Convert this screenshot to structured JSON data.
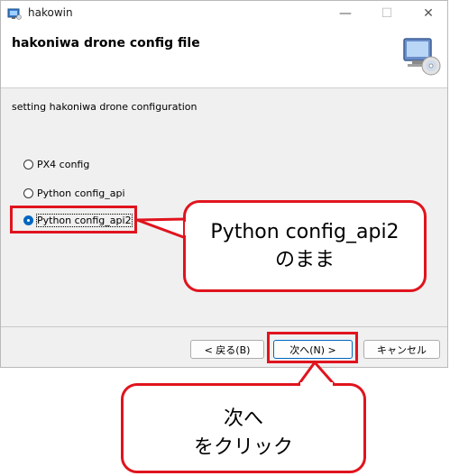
{
  "window": {
    "title": "hakowin",
    "controls": {
      "minimize": "—",
      "maximize": "☐",
      "close": "✕"
    }
  },
  "header": {
    "title": "hakoniwa drone config file",
    "icon": "computer-cd-icon"
  },
  "instruction": "setting hakoniwa drone configuration",
  "options": [
    {
      "label": "PX4 config",
      "checked": false
    },
    {
      "label": "Python config_api",
      "checked": false
    },
    {
      "label": "Python config_api2",
      "checked": true
    }
  ],
  "buttons": {
    "back": "< 戻る(B)",
    "next": "次へ(N) >",
    "cancel": "キャンセル"
  },
  "callouts": {
    "option": {
      "line1": "Python config_api2",
      "line2": "のまま"
    },
    "next": {
      "line1": "次へ",
      "line2": "をクリック"
    }
  },
  "colors": {
    "annotation_red": "#e0141e",
    "radio_blue": "#0067c0"
  }
}
